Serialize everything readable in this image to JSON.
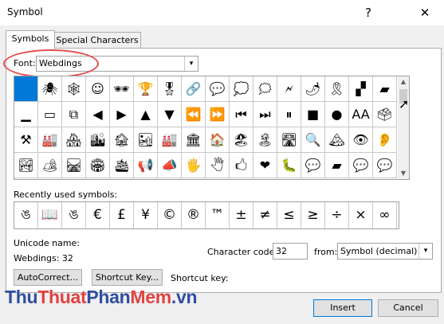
{
  "window": {
    "title": "Symbol",
    "help_glyph": "?",
    "close_glyph": "✕"
  },
  "tabs": [
    {
      "label": "Symbols",
      "active": true
    },
    {
      "label": "Special Characters",
      "active": false
    }
  ],
  "font": {
    "label": "Font:",
    "value": "Webdings",
    "dropdown_icon": "▾"
  },
  "highlight_color": "#e54b4b",
  "grid": {
    "selected_color": "#0078d7",
    "rows": [
      [
        "",
        "🕷",
        "🕸",
        "☺",
        "🕶",
        "🏆",
        "🎖",
        "🔗",
        "💬",
        "💭",
        "🗯",
        "🗲",
        "🌶",
        "🎗",
        "▞",
        "▰"
      ],
      [
        "▁",
        "▭",
        "⧉",
        "◀",
        "▶",
        "▲",
        "▼",
        "⏪",
        "⏩",
        "⏮",
        "⏭",
        "⏸",
        "■",
        "●",
        "AA",
        "🗳"
      ],
      [
        "⚒",
        "🏭",
        "🏘",
        "🏙",
        "🏚",
        "🏜",
        "🏭",
        "🏛",
        "🏠",
        "🏖",
        "🏝",
        "🛣",
        "🔍",
        "🏔",
        "👁",
        "👂"
      ],
      [
        "🏞",
        "🏕",
        "🛤",
        "🏟",
        "🛳",
        "📢",
        "📣",
        "🖐",
        "🖑",
        "🖒",
        "❤",
        "🐛",
        "💬",
        "▰",
        "💬",
        "💬"
      ]
    ],
    "scroll_up": "▲",
    "scroll_down": "▼",
    "cursor_glyph": "➚"
  },
  "recent": {
    "label": "Recently used symbols:",
    "items": [
      "ঙ",
      "📖",
      "ঙ",
      "€",
      "£",
      "¥",
      "©",
      "®",
      "™",
      "±",
      "≠",
      "≤",
      "≥",
      "÷",
      "×",
      "∞"
    ]
  },
  "unicode": {
    "name_label": "Unicode name:",
    "name_value": "Webdings: 32"
  },
  "char_code": {
    "label": "Character code:",
    "value": "32"
  },
  "from": {
    "label": "from:",
    "value": "Symbol (decimal)",
    "dropdown_icon": "▾"
  },
  "buttons": {
    "autocorrect": "AutoCorrect...",
    "shortcut_key": "Shortcut Key...",
    "insert": "Insert",
    "cancel": "Cancel"
  },
  "shortcut_key_label": "Shortcut key:",
  "watermark": {
    "part1": "Thu",
    "part2": "Thuat",
    "part3": "Phan",
    "part4": "Mem",
    "part5": ".vn"
  }
}
